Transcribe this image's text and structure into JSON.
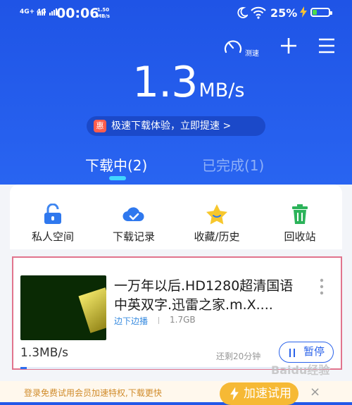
{
  "status_bar": {
    "sim1": "4G+",
    "sim2": "4G",
    "time": "00:06",
    "net_speed_value": "1.50",
    "net_speed_unit": "MB/s",
    "battery_percent": "25%",
    "battery_level": 0.25,
    "icons": [
      "signal-icon",
      "moon-icon",
      "wifi-icon",
      "charging-icon",
      "battery-icon"
    ]
  },
  "toolbar": {
    "speed_test_label": "测速",
    "icons": [
      "speedometer-icon",
      "plus-icon",
      "menu-icon"
    ]
  },
  "speed": {
    "value": "1.3",
    "unit": "MB/s"
  },
  "promo": {
    "badge": "惠",
    "text": "极速下载体验，立即提速 >"
  },
  "tabs": [
    {
      "label": "下载中(2)",
      "active": true
    },
    {
      "label": "已完成(1)",
      "active": false
    }
  ],
  "quick_actions": [
    {
      "label": "私人空间",
      "icon": "lock-icon"
    },
    {
      "label": "下载记录",
      "icon": "cloud-check-icon"
    },
    {
      "label": "收藏/历史",
      "icon": "star-icon"
    },
    {
      "label": "回收站",
      "icon": "trash-icon"
    }
  ],
  "download_item": {
    "title": "一万年以后.HD1280超清国语中英双字.迅雷之家.m.X....",
    "source": "边下边播",
    "size": "1.7GB",
    "speed": "1.3MB/s",
    "remaining": "还剩20分钟",
    "pause_label": "暂停",
    "progress": 0.02,
    "colors": {
      "accent": "#2a62ea",
      "highlight_border": "#e1748d"
    }
  },
  "trial_banner": {
    "text": "登录免费试用会员加速特权,下载更快",
    "button": "加速试用",
    "close": "×"
  },
  "watermark": "Baidu经验",
  "colors": {
    "header_blue": "#2258e8",
    "tab_indicator": "#41d6ff"
  }
}
